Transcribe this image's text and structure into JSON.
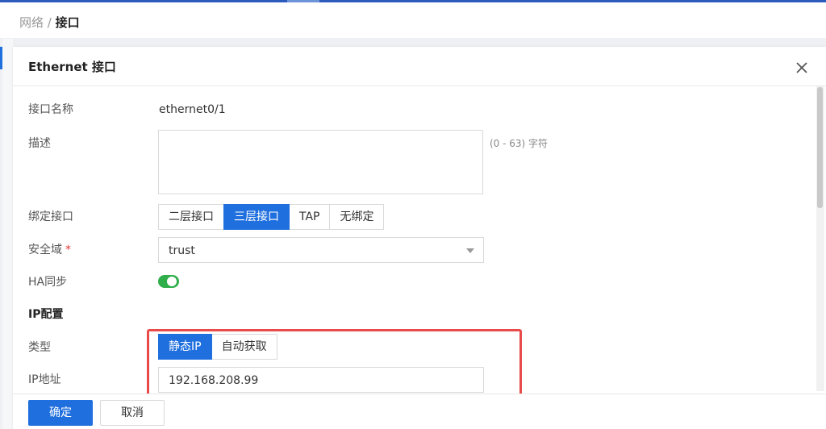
{
  "breadcrumb": {
    "parent": "网络",
    "separator": " / ",
    "current": "接口"
  },
  "dialog": {
    "title": "Ethernet 接口",
    "close_icon": "close-icon"
  },
  "form": {
    "interface_name": {
      "label": "接口名称",
      "value": "ethernet0/1"
    },
    "description": {
      "label": "描述",
      "value": "",
      "hint": "(0 - 63) 字符"
    },
    "bind_interface": {
      "label": "绑定接口",
      "options": [
        "二层接口",
        "三层接口",
        "TAP",
        "无绑定"
      ],
      "selected": "三层接口"
    },
    "security_zone": {
      "label": "安全域",
      "required_mark": "*",
      "value": "trust"
    },
    "ha_sync": {
      "label": "HA同步",
      "enabled": true
    },
    "ip_config": {
      "section_title": "IP配置",
      "type": {
        "label": "类型",
        "options": [
          "静态IP",
          "自动获取"
        ],
        "selected": "静态IP"
      },
      "ip_address": {
        "label": "IP地址",
        "value": "192.168.208.99"
      }
    }
  },
  "footer": {
    "ok_label": "确定",
    "cancel_label": "取消"
  },
  "colors": {
    "primary": "#1f6fde",
    "toggle_on": "#2fae4a",
    "highlight": "#e94b4b",
    "required": "#e4393c"
  }
}
